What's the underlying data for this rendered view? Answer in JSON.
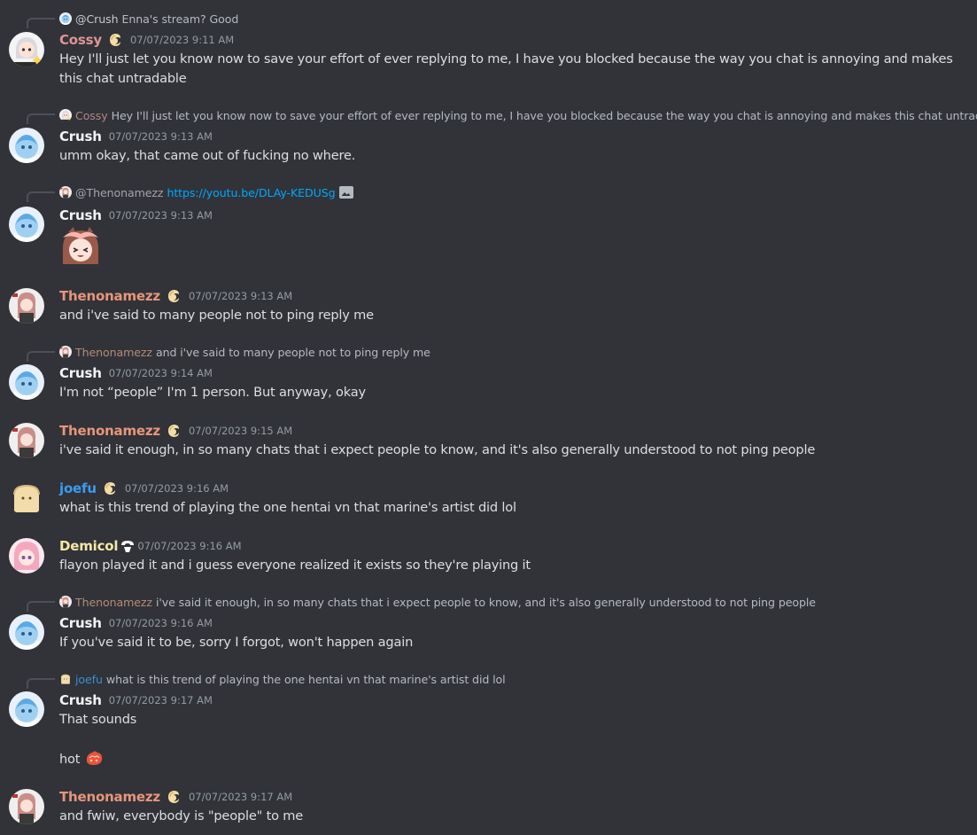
{
  "messages": [
    {
      "reply": {
        "name": "@Crush",
        "text": "Enna's stream? Good"
      },
      "author": "Cossy",
      "timestamp": "07/07/2023 9:11 AM",
      "text": "Hey I'll just let you know now to save your effort of ever replying to me, I have you blocked because the way you chat is annoying and makes this chat untradable"
    },
    {
      "reply": {
        "name": "Cossy",
        "text": "Hey I'll just let you know now to save your effort of ever replying to me, I have you blocked because the way you chat is annoying and makes this chat untradable"
      },
      "author": "Crush",
      "timestamp": "07/07/2023 9:13 AM",
      "text": "umm okay, that came out of fucking no where."
    },
    {
      "reply": {
        "name": "@Thenonamezz",
        "link": "https://youtu.be/DLAy-KEDUSg"
      },
      "author": "Crush",
      "timestamp": "07/07/2023 9:13 AM",
      "sticker": "anime-girl-sticker"
    },
    {
      "author": "Thenonamezz",
      "timestamp": "07/07/2023 9:13 AM",
      "text": "and i've said to many people not to ping reply me"
    },
    {
      "reply": {
        "name": "Thenonamezz",
        "text": "and i've said to many people not to ping reply me"
      },
      "author": "Crush",
      "timestamp": "07/07/2023 9:14 AM",
      "text": "I'm not “people” I'm 1 person. But anyway, okay"
    },
    {
      "author": "Thenonamezz",
      "timestamp": "07/07/2023 9:15 AM",
      "text": "i've said it enough, in so many chats that i expect people to know, and it's also generally understood to not ping people"
    },
    {
      "author": "joefu",
      "timestamp": "07/07/2023 9:16 AM",
      "text": "what is this trend of playing the one hentai vn that marine's artist did lol"
    },
    {
      "author": "Demicol",
      "timestamp": "07/07/2023 9:16 AM",
      "text": "flayon played it and i guess everyone realized it exists so they're playing it"
    },
    {
      "reply": {
        "name": "Thenonamezz",
        "text": "i've said it enough, in so many chats that i expect people to know, and it's also generally understood to not ping people"
      },
      "author": "Crush",
      "timestamp": "07/07/2023 9:16 AM",
      "text": "If you've said it to be, sorry I forgot, won't happen again"
    },
    {
      "reply": {
        "name": "joefu",
        "text": "what is this trend of playing the one hentai vn that marine's artist did lol"
      },
      "author": "Crush",
      "timestamp": "07/07/2023 9:17 AM",
      "text": "That sounds",
      "text2": "hot"
    },
    {
      "author": "Thenonamezz",
      "timestamp": "07/07/2023 9:17 AM",
      "text": "and fwiw, everybody is \"people\" to me"
    }
  ],
  "colors": {
    "background": "#313338",
    "cossy": "#e09494",
    "thenonamezz": "#e8957b",
    "joefu": "#3b9cf0",
    "demicol": "#f6e7a6",
    "link": "#00a8fc"
  }
}
